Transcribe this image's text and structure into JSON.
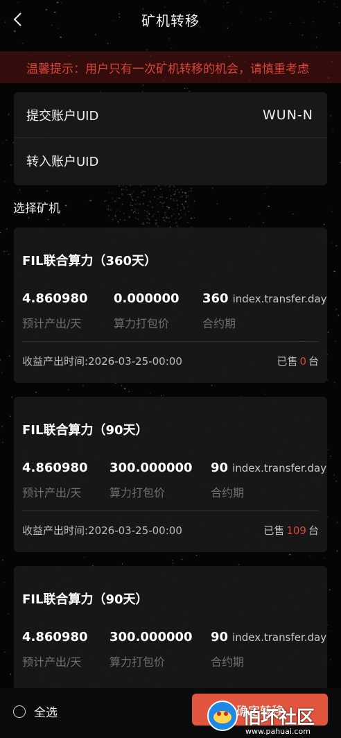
{
  "header": {
    "title": "矿机转移"
  },
  "notice": {
    "text": "温馨提示：用户只有一次矿机转移的机会，请慎重考虑"
  },
  "form": {
    "submit_uid_label": "提交账户UID",
    "submit_uid_value": "WUN-N",
    "transfer_uid_label": "转入账户UID",
    "transfer_uid_value": "",
    "transfer_uid_placeholder": ""
  },
  "section": {
    "select_miner_label": "选择矿机"
  },
  "miners": [
    {
      "name": "FIL联合算力（360天）",
      "output": "4.860980",
      "output_label": "预计产出/天",
      "price": "0.000000",
      "price_label": "算力打包价",
      "term": "360",
      "term_unit": "index.transfer.day",
      "term_label": "合约期",
      "time": "收益产出时间:2026-03-25-00:00",
      "sold_prefix": "已售",
      "sold_count": "0",
      "sold_suffix": "台"
    },
    {
      "name": "FIL联合算力（90天）",
      "output": "4.860980",
      "output_label": "预计产出/天",
      "price": "300.000000",
      "price_label": "算力打包价",
      "term": "90",
      "term_unit": "index.transfer.day",
      "term_label": "合约期",
      "time": "收益产出时间:2026-03-25-00:00",
      "sold_prefix": "已售",
      "sold_count": "109",
      "sold_suffix": "台"
    },
    {
      "name": "FIL联合算力（90天）",
      "output": "4.860980",
      "output_label": "预计产出/天",
      "price": "300.000000",
      "price_label": "算力打包价",
      "term": "90",
      "term_unit": "index.transfer.day",
      "term_label": "合约期"
    }
  ],
  "footer": {
    "select_all_label": "全选",
    "confirm_label": "确定转移"
  },
  "watermark": {
    "text": "怕坏社区",
    "url": "www.pahuai.com"
  },
  "colors": {
    "accent": "#e2553e",
    "warning_text": "#d9453a",
    "background": "#050505",
    "card": "#181818",
    "muted_text": "#6f6f6f"
  },
  "icons": {
    "back": "chevron-left-icon",
    "radio": "radio-unchecked-icon",
    "watermark_logo": "watermark-logo-icon"
  }
}
